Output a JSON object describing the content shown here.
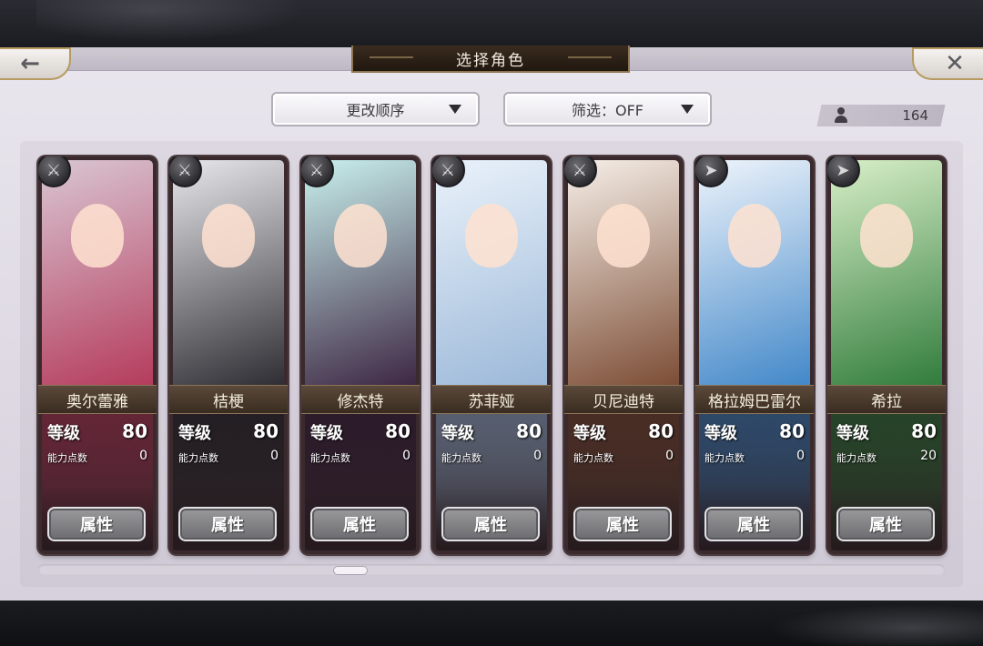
{
  "header": {
    "title": "选择角色",
    "back_icon": "back-arrow-icon",
    "close_icon": "close-icon"
  },
  "toolbar": {
    "sort_label": "更改顺序",
    "filter_label": "筛选：OFF",
    "character_count": "164"
  },
  "cards": [
    {
      "name": "奥尔蕾雅",
      "level_label": "等级",
      "level": "80",
      "ap_label": "能力点数",
      "ap": "0",
      "attr_label": "属性",
      "weapon_icon": "axe-icon",
      "palette": [
        "#d9c6d3",
        "#b4395a"
      ]
    },
    {
      "name": "桔梗",
      "level_label": "等级",
      "level": "80",
      "ap_label": "能力点数",
      "ap": "0",
      "attr_label": "属性",
      "weapon_icon": "axe-icon",
      "palette": [
        "#e8e8ec",
        "#2a2a30"
      ]
    },
    {
      "name": "修杰特",
      "level_label": "等级",
      "level": "80",
      "ap_label": "能力点数",
      "ap": "0",
      "attr_label": "属性",
      "weapon_icon": "axe-icon",
      "palette": [
        "#c9f1ee",
        "#3b2340"
      ]
    },
    {
      "name": "苏菲娅",
      "level_label": "等级",
      "level": "80",
      "ap_label": "能力点数",
      "ap": "0",
      "attr_label": "属性",
      "weapon_icon": "axe-icon",
      "palette": [
        "#eaf2fa",
        "#9ab7d8"
      ]
    },
    {
      "name": "贝尼迪特",
      "level_label": "等级",
      "level": "80",
      "ap_label": "能力点数",
      "ap": "0",
      "attr_label": "属性",
      "weapon_icon": "axe-icon",
      "palette": [
        "#f6efe8",
        "#7a4a32"
      ]
    },
    {
      "name": "格拉姆巴雷尔",
      "level_label": "等级",
      "level": "80",
      "ap_label": "能力点数",
      "ap": "0",
      "attr_label": "属性",
      "weapon_icon": "spear-icon",
      "palette": [
        "#eef4fb",
        "#3f86c8"
      ]
    },
    {
      "name": "希拉",
      "level_label": "等级",
      "level": "80",
      "ap_label": "能力点数",
      "ap": "20",
      "attr_label": "属性",
      "weapon_icon": "spear-icon",
      "palette": [
        "#d8efc7",
        "#2e7a3a"
      ]
    }
  ]
}
